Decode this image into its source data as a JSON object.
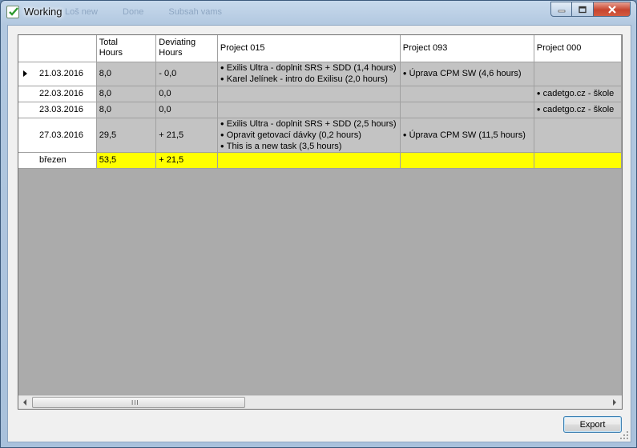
{
  "window": {
    "title": "Working",
    "ghost_menu": [
      "Loš new",
      "Done",
      "Subsah vams"
    ]
  },
  "grid": {
    "columns": [
      {
        "label": "",
        "key": "rowhdr"
      },
      {
        "label": "Total\nHours",
        "key": "total"
      },
      {
        "label": "Deviating\nHours",
        "key": "dev"
      },
      {
        "label": "Project 015",
        "key": "p015"
      },
      {
        "label": "Project 093",
        "key": "p093"
      },
      {
        "label": "Project 000",
        "key": "p000"
      }
    ],
    "rows": [
      {
        "date": "21.03.2016",
        "current": true,
        "total": "8,0",
        "dev": "- 0,0",
        "p015": [
          "Exilis Ultra - doplnit SRS + SDD (1,4 hours)",
          "Karel Jelínek - intro do Exilisu (2,0 hours)"
        ],
        "p093": [
          "Úprava CPM SW (4,6 hours)"
        ],
        "p000": []
      },
      {
        "date": "22.03.2016",
        "current": false,
        "total": "8,0",
        "dev": "0,0",
        "p015": [],
        "p093": [],
        "p000": [
          "cadetgo.cz - škole"
        ]
      },
      {
        "date": "23.03.2016",
        "current": false,
        "total": "8,0",
        "dev": "0,0",
        "p015": [],
        "p093": [],
        "p000": [
          "cadetgo.cz - škole"
        ]
      },
      {
        "date": "27.03.2016",
        "current": false,
        "total": "29,5",
        "dev": "+ 21,5",
        "p015": [
          "Exilis Ultra - doplnit SRS + SDD (2,5 hours)",
          "Opravit getovací dávky (0,2 hours)",
          "This is a new task (3,5 hours)"
        ],
        "p093": [
          "Úprava CPM SW (11,5 hours)"
        ],
        "p000": []
      }
    ],
    "summary": {
      "label": "březen",
      "total": "53,5",
      "dev": "+ 21,5"
    }
  },
  "scrollbar": {
    "grip": "III"
  },
  "footer": {
    "export_label": "Export"
  },
  "colors": {
    "summary_row": "#ffff00",
    "row_bg": "#c3c3c3",
    "empty_area": "#ababab"
  }
}
